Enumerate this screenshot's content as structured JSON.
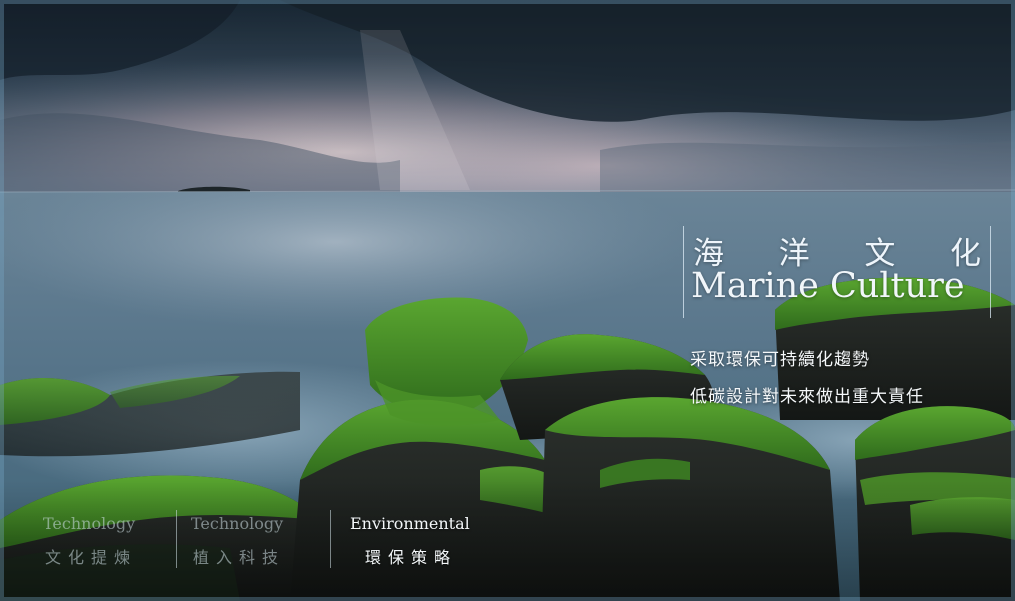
{
  "hero": {
    "title_cn": [
      "海",
      "洋",
      "文",
      "化"
    ],
    "title_en": "Marine Culture",
    "tagline_line1": "采取環保可持續化趨勢",
    "tagline_line2": "低碳設計對未來做出重大責任"
  },
  "nav": {
    "items": [
      {
        "en": "Technology",
        "cn": "文化提煉",
        "state": "inactive"
      },
      {
        "en": "Technology",
        "cn": "植入科技",
        "state": "inactive"
      },
      {
        "en": "Environmental",
        "cn": "環保策略",
        "state": "active"
      }
    ]
  },
  "colors": {
    "sky_dark": "#1e2e3c",
    "sea": "#4f6f86",
    "moss": "#3f8a22",
    "rock": "#1c201d",
    "text_light": "#f1f6fa"
  }
}
